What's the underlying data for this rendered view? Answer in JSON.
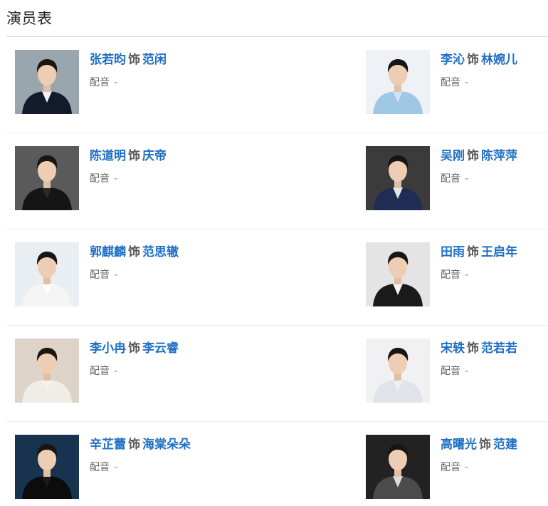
{
  "page": {
    "title": "演员表"
  },
  "cast": [
    {
      "actor": "张若昀",
      "as": "饰",
      "role": "范闲",
      "voice_label": "配音",
      "voice_value": "-",
      "photo_bg": "#9aa6ad",
      "suit": "#121a2c",
      "shirt": "#f2f2f2"
    },
    {
      "actor": "李沁",
      "as": "饰",
      "role": "林婉儿",
      "voice_label": "配音",
      "voice_value": "-",
      "photo_bg": "#eef2f6",
      "suit": "#9ec8e4",
      "shirt": "#cfe3f2"
    },
    {
      "actor": "陈道明",
      "as": "饰",
      "role": "庆帝",
      "voice_label": "配音",
      "voice_value": "-",
      "photo_bg": "#5a5a5a",
      "suit": "#151515",
      "shirt": "#2a2a2a"
    },
    {
      "actor": "吴刚",
      "as": "饰",
      "role": "陈萍萍",
      "voice_label": "配音",
      "voice_value": "-",
      "photo_bg": "#3b3b3b",
      "suit": "#1f2d55",
      "shirt": "#e6e6e6"
    },
    {
      "actor": "郭麒麟",
      "as": "饰",
      "role": "范思辙",
      "voice_label": "配音",
      "voice_value": "-",
      "photo_bg": "#e9eef2",
      "suit": "#f5f5f5",
      "shirt": "#ffffff"
    },
    {
      "actor": "田雨",
      "as": "饰",
      "role": "王启年",
      "voice_label": "配音",
      "voice_value": "-",
      "photo_bg": "#e4e4e4",
      "suit": "#1a1a1a",
      "shirt": "#f5f5f5"
    },
    {
      "actor": "李小冉",
      "as": "饰",
      "role": "李云睿",
      "voice_label": "配音",
      "voice_value": "-",
      "photo_bg": "#ddd3c9",
      "suit": "#f0ece8",
      "shirt": "#f6f1ed"
    },
    {
      "actor": "宋轶",
      "as": "饰",
      "role": "范若若",
      "voice_label": "配音",
      "voice_value": "-",
      "photo_bg": "#f1f1f3",
      "suit": "#e1e3ea",
      "shirt": "#eef0f4"
    },
    {
      "actor": "辛芷蕾",
      "as": "饰",
      "role": "海棠朵朵",
      "voice_label": "配音",
      "voice_value": "-",
      "photo_bg": "#17334f",
      "suit": "#0c0c0c",
      "shirt": "#1a1a1a"
    },
    {
      "actor": "高曙光",
      "as": "饰",
      "role": "范建",
      "voice_label": "配音",
      "voice_value": "-",
      "photo_bg": "#222222",
      "suit": "#4b4b4b",
      "shirt": "#dcdcdc"
    }
  ]
}
